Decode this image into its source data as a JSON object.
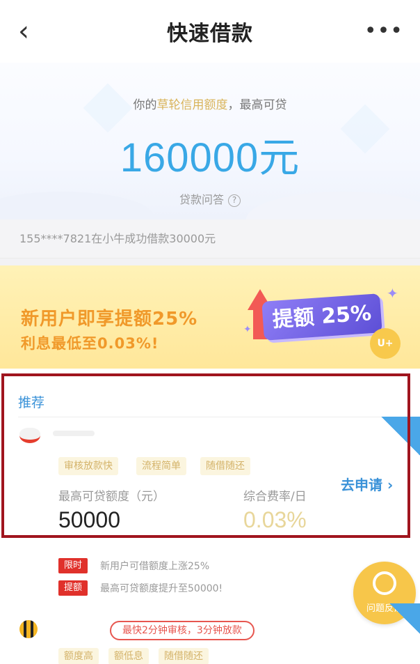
{
  "header": {
    "title": "快速借款",
    "back_icon": "‹",
    "more_icon": "•••"
  },
  "hero": {
    "subtitle_prefix": "你的",
    "subtitle_highlight": "草轮信用额度",
    "subtitle_suffix": "，最高可贷",
    "amount": "160000元",
    "faq": "贷款问答",
    "faq_icon": "?"
  },
  "ticker": {
    "text": "155****7821在小牛成功借款30000元"
  },
  "promo": {
    "line1": "新用户即享提额25%",
    "line2": "利息最低至0.03%!",
    "badge": "提额 25%",
    "coin": "U+"
  },
  "recommend": {
    "section_title": "推荐",
    "tags": [
      "审核放款快",
      "流程简单",
      "随借随还"
    ],
    "limit_label": "最高可贷额度（元）",
    "rate_label": "综合费率/日",
    "limit_value": "50000",
    "rate_value": "0.03%",
    "apply": "去申请 ›"
  },
  "notices": [
    {
      "pill": "限时",
      "text": "新用户可借额度上涨25%"
    },
    {
      "pill": "提额",
      "text": "最高可贷额度提升至50000!"
    }
  ],
  "help": {
    "label": "问题反馈"
  },
  "product2": {
    "fast_pill": "最快2分钟审核，3分钟放款",
    "tags": [
      "额度高",
      "额低息",
      "随借随还"
    ]
  },
  "colors": {
    "accent_blue": "#3a92d8",
    "amount_blue": "#39a8e6",
    "promo_orange": "#f0992a",
    "alert_red": "#e0312b",
    "highlight_box": "#a0151e"
  }
}
